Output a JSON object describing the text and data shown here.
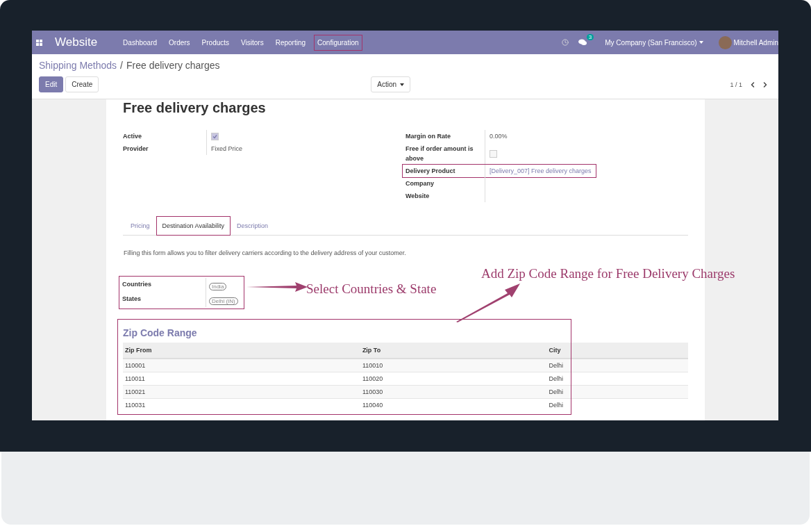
{
  "navbar": {
    "app_name": "Website",
    "menu": [
      {
        "label": "Dashboard",
        "highlighted": false
      },
      {
        "label": "Orders",
        "highlighted": false
      },
      {
        "label": "Products",
        "highlighted": false
      },
      {
        "label": "Visitors",
        "highlighted": false
      },
      {
        "label": "Reporting",
        "highlighted": false
      },
      {
        "label": "Configuration",
        "highlighted": true
      }
    ],
    "message_count": "3",
    "company": "My Company (San Francisco)",
    "user": "Mitchell Admin"
  },
  "breadcrumb": {
    "parent": "Shipping Methods",
    "separator": "/",
    "current": "Free delivery charges"
  },
  "control_panel": {
    "edit": "Edit",
    "create": "Create",
    "action": "Action",
    "pager": "1 / 1"
  },
  "form": {
    "title": "Free delivery charges",
    "left_fields": [
      {
        "label": "Active",
        "kind": "checkbox",
        "checked": true,
        "highlighted": false
      },
      {
        "label": "Provider",
        "kind": "text",
        "value": "Fixed Price",
        "highlighted": false
      }
    ],
    "right_fields": [
      {
        "label": "Margin on Rate",
        "kind": "text",
        "value": "0.00%",
        "highlighted": false
      },
      {
        "label": "Free if order amount is above",
        "kind": "checkbox",
        "checked": false,
        "highlighted": false
      },
      {
        "label": "Delivery Product",
        "kind": "link",
        "value": "[Delivery_007] Free delivery charges",
        "highlighted": true
      },
      {
        "label": "Company",
        "kind": "empty",
        "highlighted": false
      },
      {
        "label": "Website",
        "kind": "empty",
        "highlighted": false
      }
    ],
    "tabs": [
      {
        "label": "Pricing",
        "selected": false,
        "highlighted": false
      },
      {
        "label": "Destination Availability",
        "selected": true,
        "highlighted": true
      },
      {
        "label": "Description",
        "selected": false,
        "highlighted": false
      }
    ],
    "description": "Filling this form allows you to filter delivery carriers according to the delivery address of your customer.",
    "destination": {
      "highlighted": true,
      "fields": [
        {
          "label": "Countries",
          "tags": [
            "India"
          ]
        },
        {
          "label": "States",
          "tags": [
            "Delhi (IN)"
          ]
        }
      ]
    },
    "zip_section": {
      "title": "Zip Code Range",
      "highlighted": true,
      "columns": [
        "Zip From",
        "Zip To",
        "City"
      ],
      "rows": [
        [
          "110001",
          "110010",
          "Delhi"
        ],
        [
          "110011",
          "110020",
          "Delhi"
        ],
        [
          "110021",
          "110030",
          "Delhi"
        ],
        [
          "110031",
          "110040",
          "Delhi"
        ]
      ]
    }
  },
  "annotations": [
    {
      "text": "Select Countries & State"
    },
    {
      "text": "Add Zip Code Range for Free Delivery Charges"
    }
  ]
}
